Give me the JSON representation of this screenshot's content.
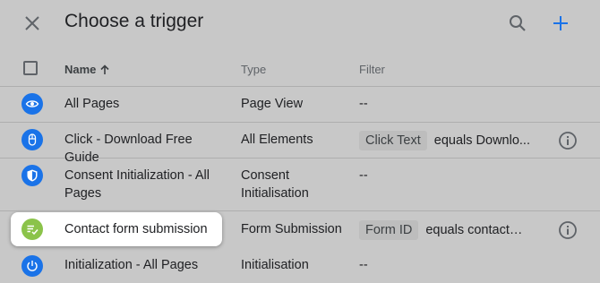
{
  "header": {
    "title": "Choose a trigger"
  },
  "columns": {
    "name": "Name",
    "type": "Type",
    "filter": "Filter"
  },
  "colors": {
    "blue_icon": "#1a73e8",
    "green_icon": "#8bc34a",
    "add_accent": "#1a73e8"
  },
  "rows": [
    {
      "name": "All Pages",
      "type": "Page View",
      "filter_text": "--",
      "icon": "eye-icon",
      "color": "#1a73e8"
    },
    {
      "name": "Click - Download Free Guide",
      "type": "All Elements",
      "filter_chip": "Click Text",
      "filter_text": "equals Downlo...",
      "icon": "mouse-icon",
      "color": "#1a73e8"
    },
    {
      "name": "Consent Initialization - All Pages",
      "type": "Consent Initialisation",
      "filter_text": "--",
      "icon": "shield-icon",
      "color": "#1a73e8"
    },
    {
      "name": "Contact form submission",
      "type": "Form Submission",
      "filter_chip": "Form ID",
      "filter_text": "equals contact-u...",
      "icon": "form-check-icon",
      "color": "#8bc34a"
    },
    {
      "name": "Initialization - All Pages",
      "type": "Initialisation",
      "filter_text": "--",
      "icon": "power-icon",
      "color": "#1a73e8"
    }
  ]
}
